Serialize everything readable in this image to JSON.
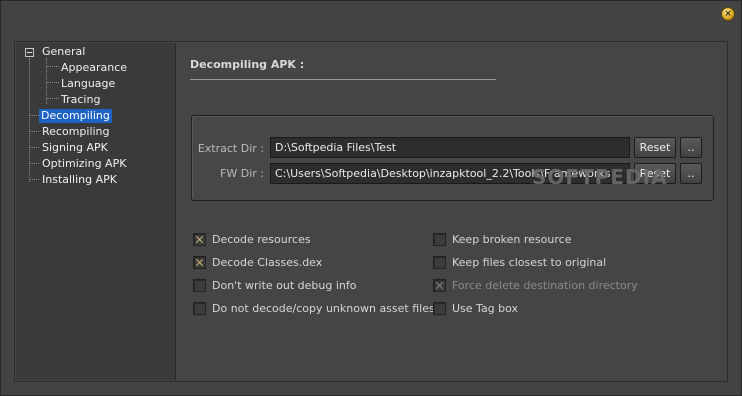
{
  "titlebar": {
    "close_icon": "close-icon"
  },
  "sidebar": {
    "items": [
      {
        "label": "General",
        "level": 0,
        "expanded": true
      },
      {
        "label": "Appearance",
        "level": 1
      },
      {
        "label": "Language",
        "level": 1
      },
      {
        "label": "Tracing",
        "level": 1
      },
      {
        "label": "Decompiling",
        "level": 0,
        "selected": true
      },
      {
        "label": "Recompiling",
        "level": 0
      },
      {
        "label": "Signing APK",
        "level": 0
      },
      {
        "label": "Optimizing APK",
        "level": 0
      },
      {
        "label": "Installing APK",
        "level": 0
      }
    ]
  },
  "main": {
    "title": "Decompiling APK :",
    "extract_dir": {
      "label": "Extract Dir :",
      "value": "D:\\Softpedia Files\\Test",
      "reset_label": "Reset",
      "browse_label": ".."
    },
    "fw_dir": {
      "label": "FW Dir :",
      "value": "C:\\Users\\Softpedia\\Desktop\\inzapktool_2.2\\Tools\\Frameworks",
      "reset_label": "Reset",
      "browse_label": ".."
    },
    "watermark": "SOFTPEDIA",
    "options_left": [
      {
        "label": "Decode resources",
        "checked": true,
        "enabled": true
      },
      {
        "label": "Decode Classes.dex",
        "checked": true,
        "enabled": true
      },
      {
        "label": "Don't write out debug info",
        "checked": false,
        "enabled": true
      },
      {
        "label": "Do not decode/copy unknown asset files",
        "checked": false,
        "enabled": true
      }
    ],
    "options_right": [
      {
        "label": "Keep broken resource",
        "checked": false,
        "enabled": true
      },
      {
        "label": "Keep files closest to original",
        "checked": false,
        "enabled": true
      },
      {
        "label": "Force delete destination directory",
        "checked": true,
        "enabled": false
      },
      {
        "label": "Use Tag box",
        "checked": false,
        "enabled": true
      }
    ]
  },
  "colors": {
    "background": "#434343",
    "selection": "#1e63c4",
    "sidebar_bg": "#3a3a3a"
  }
}
